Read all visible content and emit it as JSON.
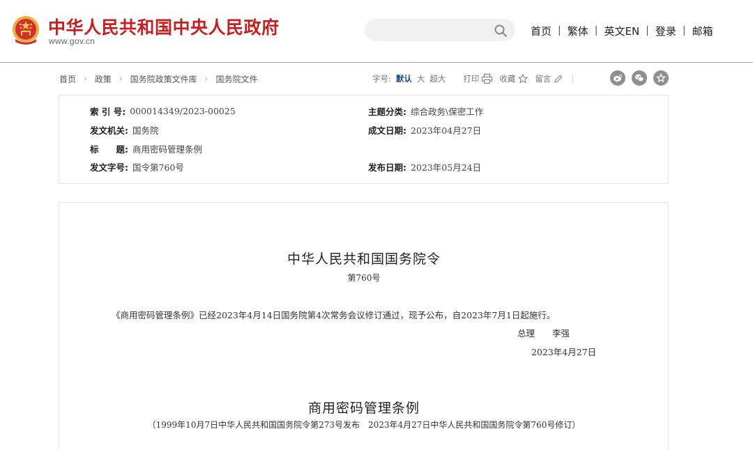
{
  "header": {
    "site_title": "中华人民共和国中央人民政府",
    "site_url": "www.gov.cn",
    "search_placeholder": "",
    "nav": [
      "首页",
      "繁体",
      "英文EN",
      "登录",
      "邮箱"
    ],
    "nav_separator": "|"
  },
  "breadcrumb": {
    "items": [
      "首页",
      "政策",
      "国务院政策文件库",
      "国务院文件"
    ],
    "separator": "›"
  },
  "tools": {
    "font_size_label": "字号:",
    "font_default": "默认",
    "font_large": "大",
    "font_xlarge": "超大",
    "print": "打印",
    "favorite": "收藏",
    "comment": "留言"
  },
  "share_icons": [
    "weibo-icon",
    "wechat-icon",
    "favorite-star-icon"
  ],
  "meta": {
    "index_no_key": "索 引 号:",
    "index_no_val": "000014349/2023-00025",
    "category_key": "主题分类:",
    "category_val": "综合政务\\保密工作",
    "issuer_key": "发文机关:",
    "issuer_val": "国务院",
    "written_date_key": "成文日期:",
    "written_date_val": "2023年04月27日",
    "title_key": "标　　题:",
    "title_val": "商用密码管理条例",
    "doc_no_key": "发文字号:",
    "doc_no_val": "国令第760号",
    "publish_date_key": "发布日期:",
    "publish_date_val": "2023年05月24日"
  },
  "content": {
    "order_title": "中华人民共和国国务院令",
    "order_no": "第760号",
    "body": "《商用密码管理条例》已经2023年4月14日国务院第4次常务会议修订通过，现予公布，自2023年7月1日起施行。",
    "signer": "总理　　李强",
    "sign_date": "2023年4月27日",
    "regulation_title": "商用密码管理条例",
    "regulation_note": "（1999年10月7日中华人民共和国国务院令第273号发布　2023年4月27日中华人民共和国国务院令第760号修订）"
  },
  "colors": {
    "brand_red": "#c81e1e",
    "emblem_gold": "#e8b13a",
    "active_blue": "#1a4d8f",
    "share_grey": "#8f8f8f"
  }
}
